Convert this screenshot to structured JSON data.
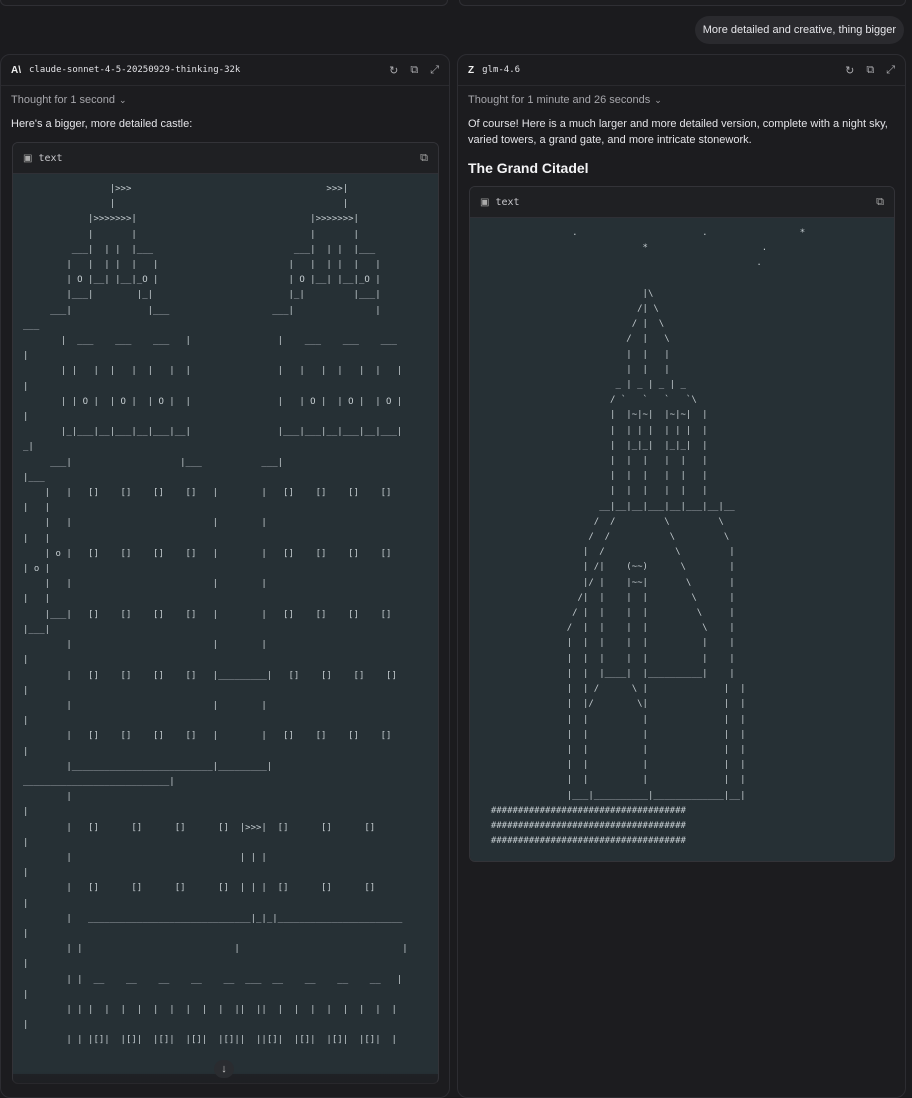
{
  "user_message": "More detailed and creative, thing bigger",
  "left": {
    "logo": "A\\",
    "model": "claude-sonnet-4-5-20250929-thinking-32k",
    "icons": {
      "regenerate": "↻",
      "copy": "⧉",
      "expand": "⤢"
    },
    "thought": "Thought for 1 second",
    "intro": "Here's a bigger, more detailed castle:",
    "code_lang": "text",
    "art": "                |>>>                                    >>>|\n                |                                          |\n            |>>>>>>>|                                |>>>>>>>|\n            |       |                                |       |\n         ___|  | |  |___                          ___|  | |  |___\n        |   |  | |  |   |                        |   |  | |  |   |\n        | O |__| |__|_O |                        | O |__| |__|_O |\n        |___|        |_|                         |_|         |___|\n     ___|              |___                   ___|               |\n___\n       |  ___    ___    ___   |                |    ___    ___    ___\n|\n       | |   |  |   |  |   |  |                |   |   |  |   |  |   |\n|\n       | | O |  | O |  | O |  |                |   | O |  | O |  | O |\n|\n       |_|___|__|___|__|___|__|                |___|___|__|___|__|___|\n_|\n     ___|                    |___           ___|\n|___\n    |   |   []    []    []    []   |        |   []    []    []    []\n|   |\n    |   |                          |        |\n|   |\n    | o |   []    []    []    []   |        |   []    []    []    []\n| o |\n    |   |                          |        |\n|   |\n    |___|   []    []    []    []   |        |   []    []    []    []\n|___|\n        |                          |        |\n|\n        |   []    []    []    []   |_________|   []    []    []    []\n|\n        |                          |        |\n|\n        |   []    []    []    []   |        |   []    []    []    []\n|\n        |__________________________|_________|\n___________________________|\n        |\n|\n        |   []      []      []      []  |>>>|  []      []      []\n|\n        |                               | | |\n|\n        |   []      []      []      []  | | |  []      []      []\n|\n        |   ______________________________|_|_|_______________________\n|\n        | |                            |                              |\n|\n        | |  __    __    __    __    __  ___  __    __    __    __   |\n|\n        | | |  |  |  |  |  |  |  |  |  ||  ||  |  |  |  |  |  |  |  |\n|\n        | | |[]|  |[]|  |[]|  |[]|  |[]||  ||[]|  |[]|  |[]|  |[]|  |"
  },
  "right": {
    "logo": "Z",
    "model": "glm-4.6",
    "icons": {
      "regenerate": "↻",
      "copy": "⧉",
      "expand": "⤢"
    },
    "thought": "Thought for 1 minute and 26 seconds",
    "intro": "Of course! Here is a much larger and more detailed version, complete with a night sky, varied towers, a grand gate, and more intricate stonework.",
    "section_title": "The Grand Citadel",
    "code_lang": "text",
    "art": "                 .                       .                 *\n                              *                     .\n                                                   .\n\n                              |\\\n                             /| \\\n                            / |  \\\n                           /  |   \\\n                           |  |   |\n                           |  |   |\n                         _ | _ | _ | _\n                        / `   `   `   `\\\n                        |  |~|~|  |~|~|  |\n                        |  | | |  | | |  |\n                        |  |_|_|  |_|_|  |\n                        |  |  |   |  |   |\n                        |  |  |   |  |   |\n                        |  |  |   |  |   |\n                      __|__|__|___|__|___|__|__\n                     /  /         \\         \\\n                    /  /           \\         \\\n                   |  /             \\         |\n                   | /|    (~~)      \\        |\n                   |/ |    |~~|       \\       |\n                  /|  |    |  |        \\      |\n                 / |  |    |  |         \\     |\n                /  |  |    |  |          \\    |\n                |  |  |    |  |          |    |\n                |  |  |    |  |          |    |\n                |  |  |____|  |__________|    |\n                |  | /      \\ |              |  |\n                |  |/        \\|              |  |\n                |  |          |              |  |\n                |  |          |              |  |\n                |  |          |              |  |\n                |  |          |              |  |\n                |  |          |              |  |\n                |___|__________|_____________|__|\n  ####################################\n  ####################################\n  ####################################"
  },
  "scroll_icon": "↓"
}
